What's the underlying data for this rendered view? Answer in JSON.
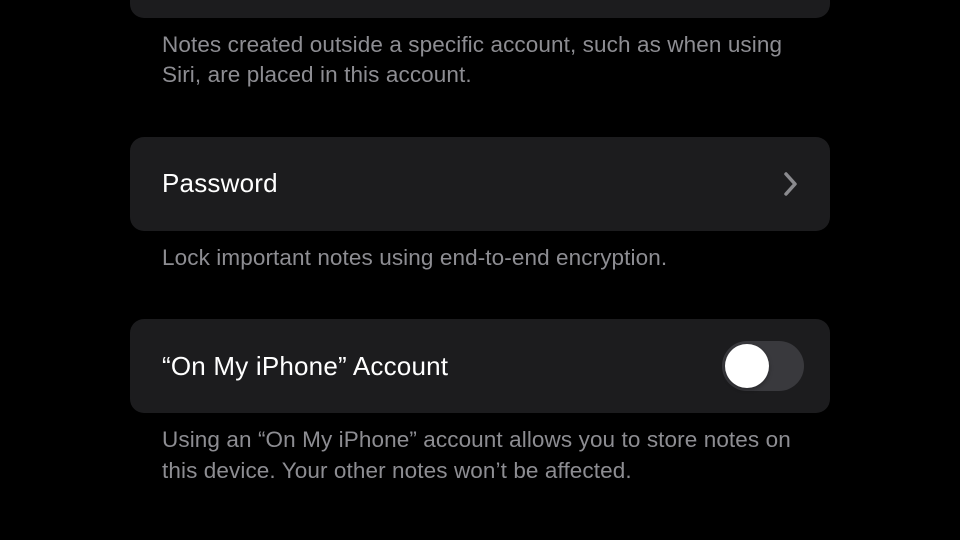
{
  "sections": {
    "defaultAccount": {
      "footer": "Notes created outside a specific account, such as when using Siri, are placed in this account."
    },
    "password": {
      "label": "Password",
      "footer": "Lock important notes using end-to-end encryption."
    },
    "onMyIphone": {
      "label": "“On My iPhone” Account",
      "toggle_on": false,
      "footer": "Using an “On My iPhone” account allows you to store notes on this device. Your other notes won’t be affected."
    }
  }
}
